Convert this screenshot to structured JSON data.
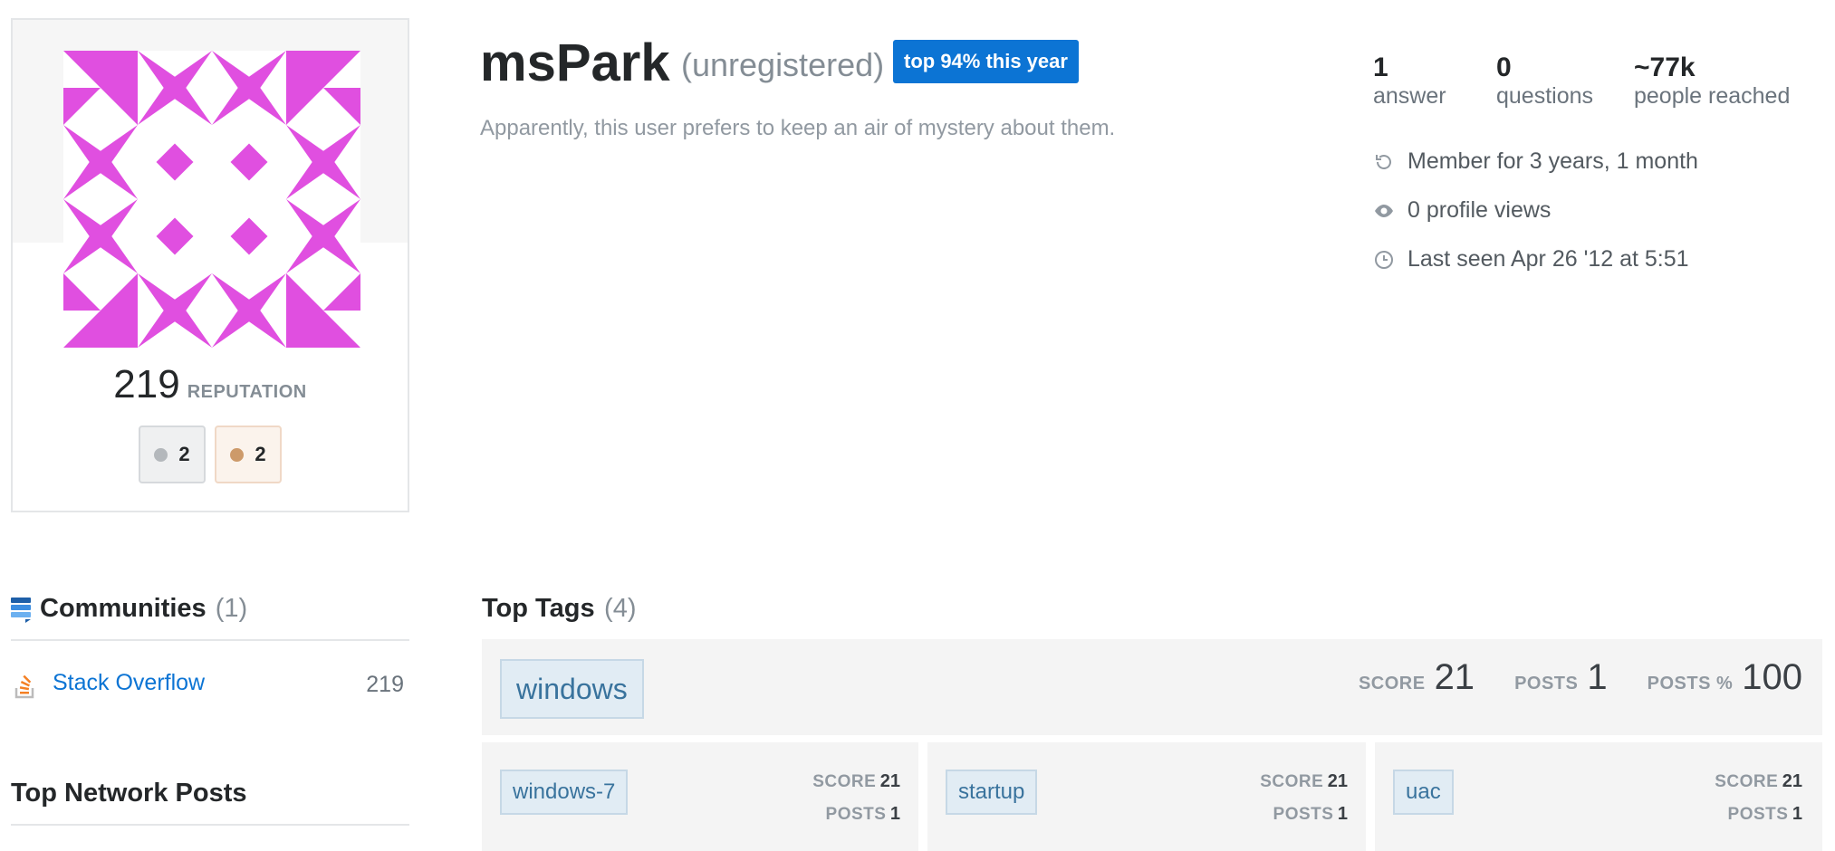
{
  "profile": {
    "username": "msPark",
    "status": "(unregistered)",
    "top_badge": "top 94% this year",
    "bio": "Apparently, this user prefers to keep an air of mystery about them.",
    "reputation": "219",
    "reputation_label": "REPUTATION",
    "badges": {
      "silver": "2",
      "bronze": "2"
    },
    "avatar_color": "#e04fe0"
  },
  "stats": [
    {
      "value": "1",
      "label": "answer"
    },
    {
      "value": "0",
      "label": "questions"
    },
    {
      "value": "~77k",
      "label": "people reached"
    }
  ],
  "meta": {
    "member_for": "Member for 3 years, 1 month",
    "profile_views": "0 profile views",
    "last_seen": "Last seen Apr 26 '12 at 5:51"
  },
  "communities": {
    "title": "Communities",
    "count": "(1)",
    "items": [
      {
        "name": "Stack Overflow",
        "reputation": "219"
      }
    ]
  },
  "top_network_posts": {
    "title": "Top Network Posts"
  },
  "top_tags": {
    "title": "Top Tags",
    "count": "(4)",
    "score_label": "SCORE",
    "posts_label": "POSTS",
    "posts_pct_label": "POSTS %",
    "main": {
      "name": "windows",
      "score": "21",
      "posts": "1",
      "posts_pct": "100"
    },
    "others": [
      {
        "name": "windows-7",
        "score": "21",
        "posts": "1"
      },
      {
        "name": "startup",
        "score": "21",
        "posts": "1"
      },
      {
        "name": "uac",
        "score": "21",
        "posts": "1"
      }
    ]
  }
}
